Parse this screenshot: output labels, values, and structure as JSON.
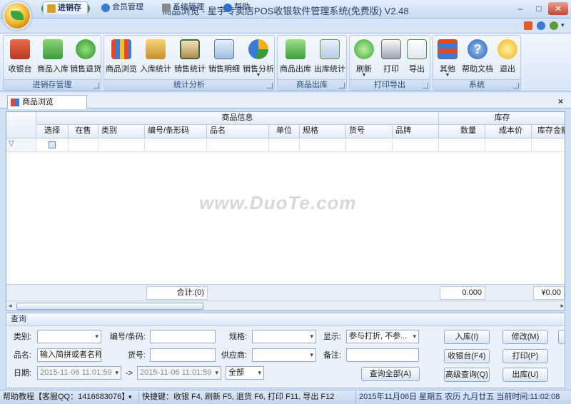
{
  "window": {
    "title": "商品浏览 - 星宇专卖店POS收银软件管理系统(免费版) V2.48",
    "min_label": "–",
    "max_label": "□",
    "close_label": "✕"
  },
  "ribbon_tabs": [
    {
      "label": "进销存",
      "active": true
    },
    {
      "label": "会员管理"
    },
    {
      "label": "系统管理"
    },
    {
      "label": "帮助"
    }
  ],
  "ribbon_groups": [
    {
      "label": "进销存管理",
      "buttons": [
        {
          "label": "收银台",
          "icon": "cash-register-icon"
        },
        {
          "label": "商品入库",
          "icon": "stock-in-icon"
        },
        {
          "label": "销售退货",
          "icon": "sales-return-icon"
        }
      ]
    },
    {
      "label": "统计分析",
      "buttons": [
        {
          "label": "商品浏览",
          "icon": "product-browse-icon"
        },
        {
          "label": "入库统计",
          "icon": "stock-stats-icon"
        },
        {
          "label": "销售统计",
          "icon": "sales-stats-icon"
        },
        {
          "label": "销售明细",
          "icon": "sales-detail-icon"
        },
        {
          "label": "销售分析",
          "icon": "pie-chart-icon",
          "dropdown": true
        }
      ]
    },
    {
      "label": "商品出库",
      "buttons": [
        {
          "label": "商品出库",
          "icon": "stock-out-icon"
        },
        {
          "label": "出库统计",
          "icon": "stock-out-stats-icon"
        }
      ]
    },
    {
      "label": "打印导出",
      "buttons": [
        {
          "label": "刷新",
          "icon": "refresh-icon",
          "dropdown": true
        },
        {
          "label": "打印",
          "icon": "printer-icon"
        },
        {
          "label": "导出",
          "icon": "export-icon"
        }
      ]
    },
    {
      "label": "系统",
      "buttons": [
        {
          "label": "其他",
          "icon": "other-icon",
          "dropdown": true
        },
        {
          "label": "帮助文档",
          "icon": "help-icon"
        },
        {
          "label": "退出",
          "icon": "exit-icon"
        }
      ]
    }
  ],
  "doc_tab": {
    "label": "商品浏览",
    "close": "×"
  },
  "grid": {
    "group_headers": {
      "product_info": "商品信息",
      "stock": "库存"
    },
    "columns": [
      "选择",
      "在售",
      "类别",
      "编号/条形码",
      "品名",
      "单位",
      "规格",
      "货号",
      "品牌",
      "数量",
      "成本价",
      "库存金额"
    ],
    "filter_icon": "funnel-icon",
    "footer": {
      "total_label": "合计:(0)",
      "qty_total": "0.000",
      "amount_total": "¥0.00"
    }
  },
  "query": {
    "title": "查询",
    "fields": {
      "category_label": "类别:",
      "code_label": "编号/条码:",
      "spec_label": "规格:",
      "display_label": "显示:",
      "display_value": "参与打折, 不参...",
      "name_label": "品名:",
      "name_placeholder": "输入简拼或者名称",
      "item_no_label": "货号:",
      "supplier_label": "供应商:",
      "remark_label": "备注:",
      "date_label": "日期:",
      "date_from": "2015-11-06 11:01:59",
      "date_sep": "->",
      "date_to": "2015-11-06 11:01:59",
      "range_value": "全部"
    },
    "buttons": {
      "query_all": "查询全部(A)",
      "stock_in": "入库(I)",
      "modify": "修改(M)",
      "checkout": "收银台(F4)",
      "print": "打印(P)",
      "advanced": "高级查询(Q)",
      "stock_out": "出库(U)"
    }
  },
  "status": {
    "help": "帮助教程【客服QQ：1416683076】",
    "shortcuts": "快捷键：收银 F4, 刷新 F5, 退货 F6, 打印 F11, 导出 F12",
    "datetime": "2015年11月06日 星期五 农历 九月廿五 当前时间:11:02:08"
  },
  "watermark": "www.DuoTe.com",
  "colors": {
    "accent": "#3a7bd5",
    "ribbon_bg": "#dde9f8",
    "status_bg": "#c2d5ee"
  }
}
